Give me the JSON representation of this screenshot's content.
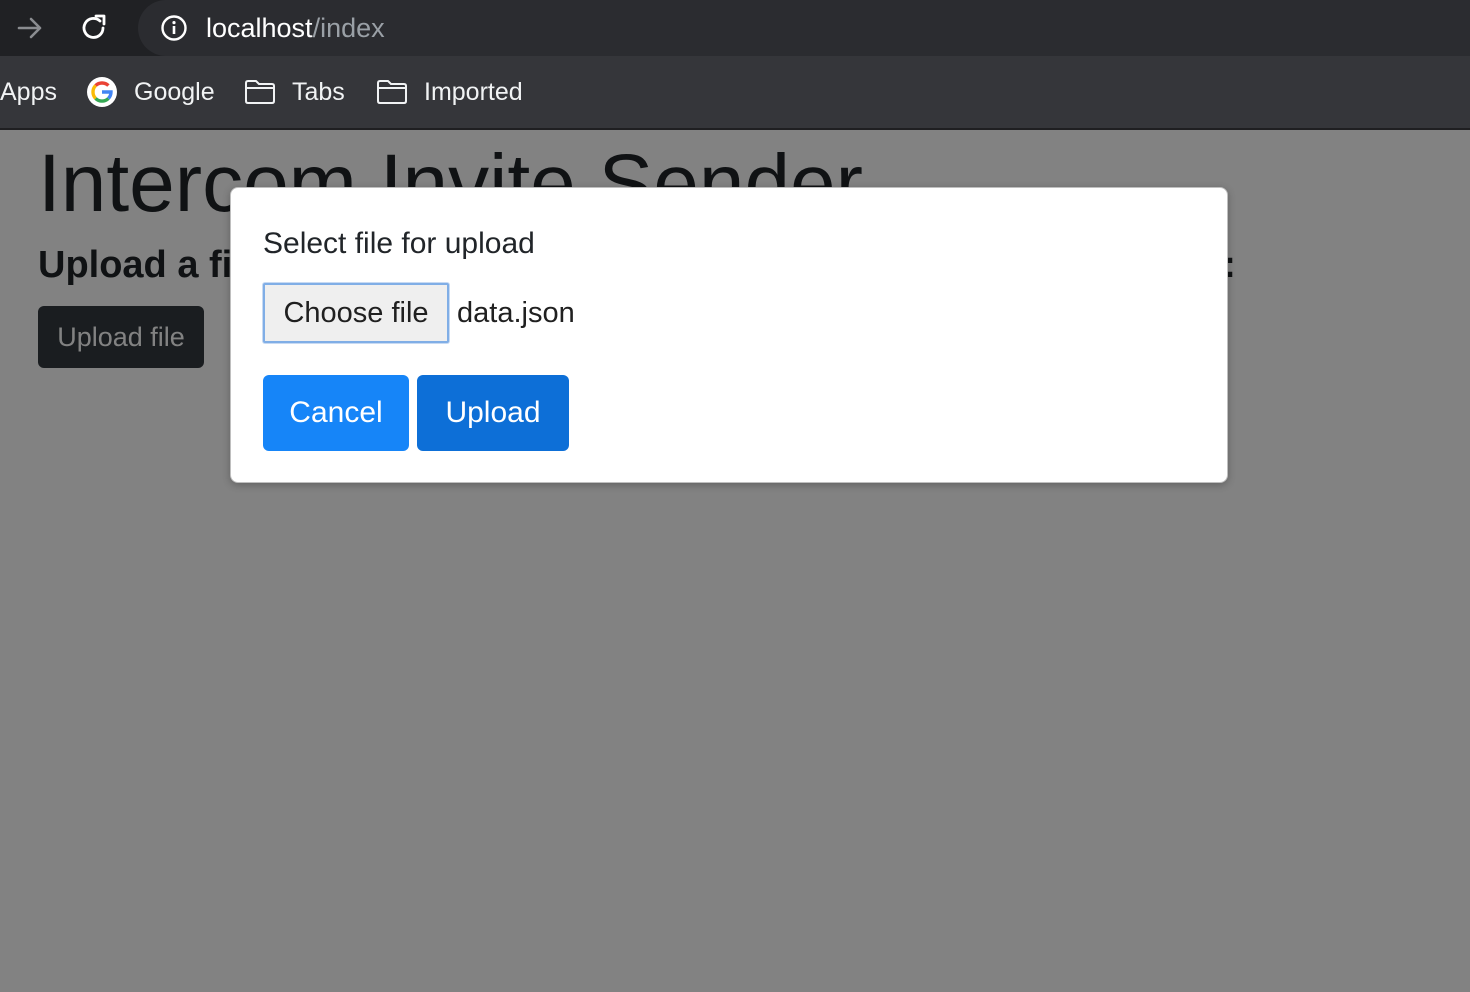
{
  "browser": {
    "url_host": "localhost",
    "url_path": "/index",
    "bookmarks": [
      {
        "label": "Apps",
        "icon": "apps-icon"
      },
      {
        "label": "Google",
        "icon": "google-icon"
      },
      {
        "label": "Tabs",
        "icon": "folder-icon"
      },
      {
        "label": "Imported",
        "icon": "folder-icon"
      }
    ]
  },
  "page": {
    "title": "Intercom Invite Sender",
    "subtitle_visible_left": "Upload a fi",
    "subtitle_visible_right": "n:",
    "upload_file_button": "Upload file"
  },
  "modal": {
    "label": "Select file for upload",
    "choose_file_button": "Choose file",
    "file_name": "data.json",
    "cancel_button": "Cancel",
    "upload_button": "Upload"
  },
  "colors": {
    "primary": "#1685f8",
    "primary_active": "#0d6fd7",
    "dark_button": "#343a40",
    "backdrop": "rgba(0,0,0,0.49)"
  }
}
